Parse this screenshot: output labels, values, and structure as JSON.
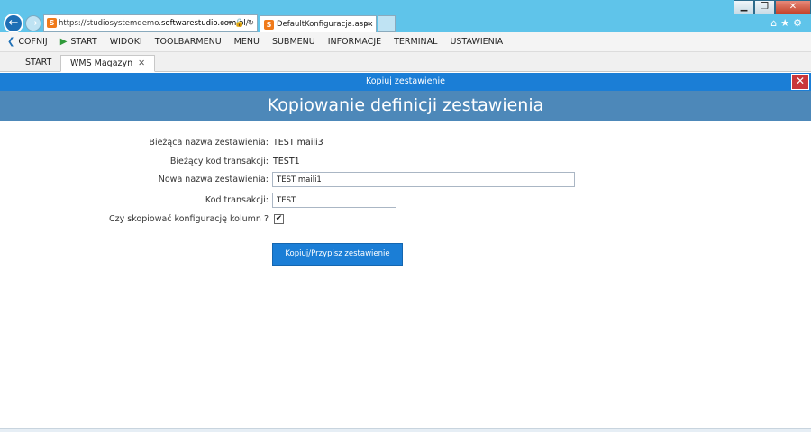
{
  "browser": {
    "url_prefix": "https://studiosystemdemo.",
    "url_host": "softwarestudio.com.pl",
    "url_suffix": "/",
    "tab_title": "DefaultKonfiguracja.aspx"
  },
  "menu": {
    "items": [
      "COFNIJ",
      "START",
      "WIDOKI",
      "TOOLBARMENU",
      "MENU",
      "SUBMENU",
      "INFORMACJE",
      "TERMINAL",
      "USTAWIENIA"
    ]
  },
  "tabs": [
    {
      "label": "START"
    },
    {
      "label": "WMS Magazyn"
    }
  ],
  "dialog": {
    "header": "Kopiuj zestawienie",
    "title": "Kopiowanie definicji zestawienia"
  },
  "form": {
    "current_name_label": "Bieżąca nazwa zestawienia:",
    "current_name_value": "TEST maili3",
    "current_code_label": "Bieżący kod transakcji:",
    "current_code_value": "TEST1",
    "new_name_label": "Nowa nazwa zestawienia:",
    "new_name_value": "TEST maili1",
    "code_label": "Kod transakcji:",
    "code_value": "TEST",
    "copy_columns_label": "Czy skopiować konfigurację kolumn ?",
    "copy_columns_checked": true,
    "submit_label": "Kopiuj/Przypisz zestawienie"
  },
  "colors": {
    "accent": "#1b7ed6",
    "banner": "#4d88b9",
    "close": "#c9363a",
    "chrome": "#5fc4ea"
  }
}
